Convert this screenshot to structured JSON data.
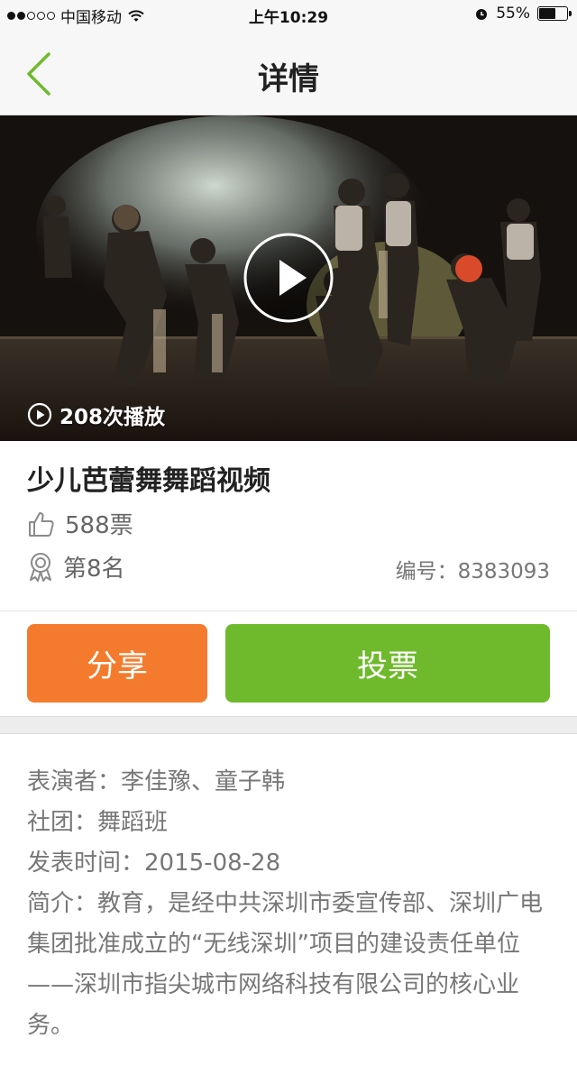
{
  "status_bar": {
    "carrier": "中国移动",
    "time": "上午10:29",
    "battery_percent": "55%",
    "battery_level": 0.55,
    "signal_bars_filled": 2,
    "signal_bars_total": 5
  },
  "nav": {
    "title": "详情",
    "back_icon": "chevron-left-icon"
  },
  "video": {
    "play_count": "208次播放",
    "play_icon": "play-icon"
  },
  "detail": {
    "title": "少儿芭蕾舞舞蹈视频",
    "votes": "588票",
    "rank": "第8名",
    "serial_label": "编号：",
    "serial_value": "8383093"
  },
  "actions": {
    "share_label": "分享",
    "vote_label": "投票"
  },
  "info": {
    "performer_label": "表演者：",
    "performer_value": "李佳豫、童子韩",
    "club_label": "社团：",
    "club_value": "舞蹈班",
    "date_label": "发表时间：",
    "date_value": "2015-08-28",
    "intro_label": "简介：",
    "intro_value": "教育，是经中共深圳市委宣传部、深圳广电集团批准成立的“无线深圳”项目的建设责任单位——深圳市指尖城市网络科技有限公司的核心业务。"
  },
  "colors": {
    "accent_green": "#6fba2c",
    "accent_orange": "#f47b2d",
    "back_chevron": "#6fba2c"
  }
}
